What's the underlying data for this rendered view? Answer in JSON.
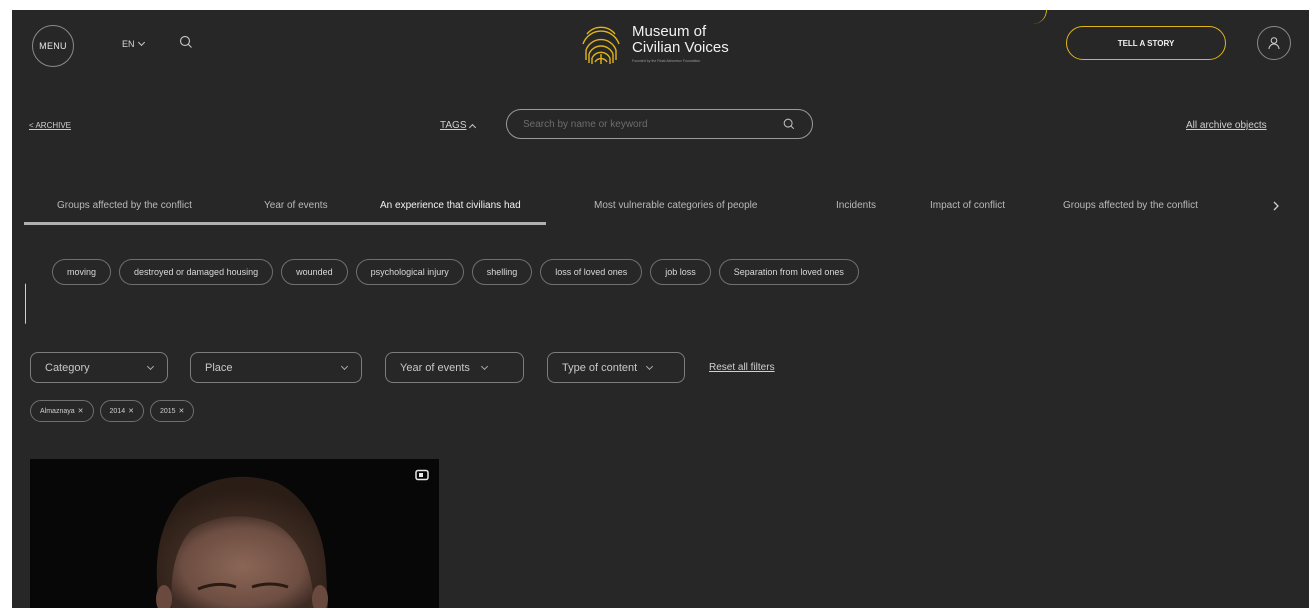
{
  "header": {
    "menu_label": "MENU",
    "language": "EN",
    "logo_line1": "Museum of",
    "logo_line2": "Civilian Voices",
    "logo_subtitle": "Founded by the Rinat Akhmetov Foundation",
    "tell_story_label": "TELL A STORY"
  },
  "archive_bar": {
    "archive_label": "ARCHIVE",
    "tags_label": "TAGS",
    "search_placeholder": "Search by name or keyword",
    "all_objects_label": "All archive objects"
  },
  "tag_tabs": [
    {
      "label": "Groups affected by the conflict",
      "active": false
    },
    {
      "label": "Year of events",
      "active": false
    },
    {
      "label": "An experience that civilians had",
      "active": true
    },
    {
      "label": "Most vulnerable categories of people",
      "active": false
    },
    {
      "label": "Incidents",
      "active": false
    },
    {
      "label": "Impact of conflict",
      "active": false
    },
    {
      "label": "Groups affected by the conflict",
      "active": false
    }
  ],
  "tag_chips": [
    "moving",
    "destroyed or damaged housing",
    "wounded",
    "psychological injury",
    "shelling",
    "loss of loved ones",
    "job loss",
    "Separation from loved ones"
  ],
  "filters": {
    "category": "Category",
    "place": "Place",
    "year": "Year of events",
    "type": "Type of content",
    "reset_label": "Reset all filters"
  },
  "selected_filters": [
    "Almaznaya",
    "2014",
    "2015"
  ],
  "colors": {
    "background": "#272727",
    "accent": "#e1b51a",
    "text": "#d7d7d7"
  },
  "card": {
    "media_icon": "video-icon"
  }
}
